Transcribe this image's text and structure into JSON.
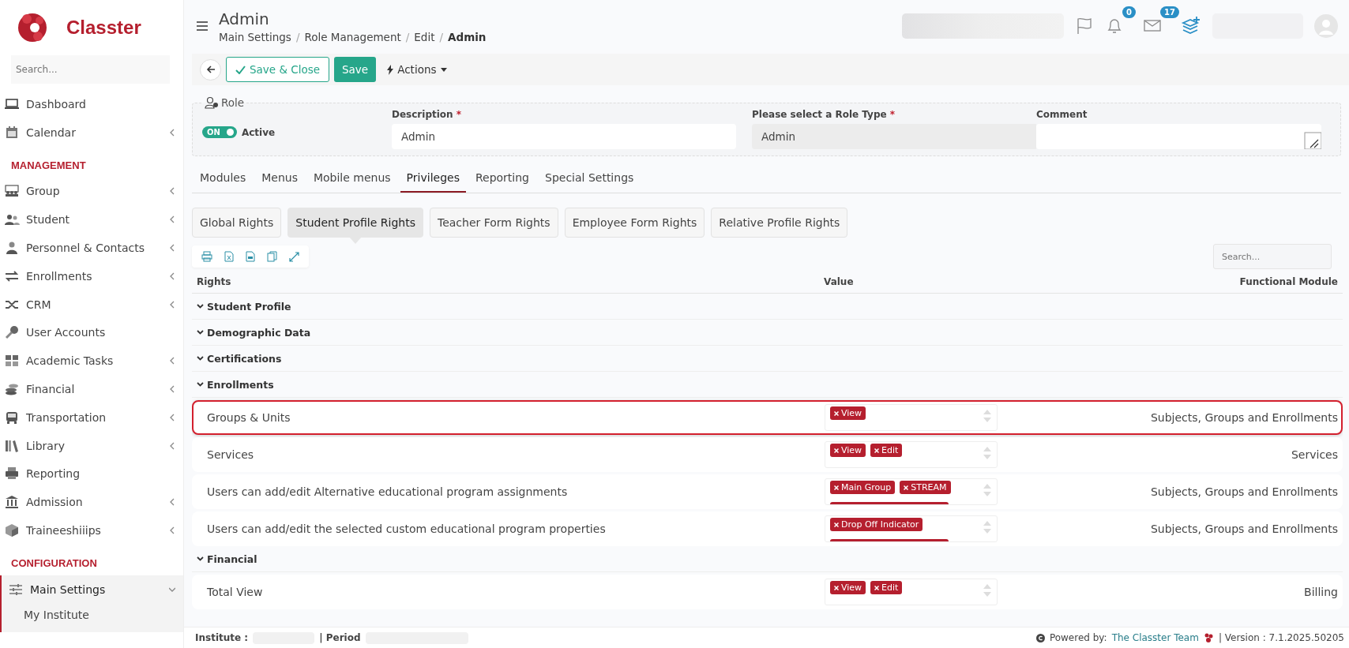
{
  "brand": {
    "name": "Classter"
  },
  "sidebar": {
    "search_placeholder": "Search...",
    "sections": [
      {
        "items": [
          {
            "label": "Dashboard",
            "expandable": false,
            "selected": false
          },
          {
            "label": "Calendar",
            "expandable": true,
            "selected": false
          }
        ]
      },
      {
        "heading": "MANAGEMENT",
        "items": [
          {
            "label": "Group",
            "expandable": true,
            "selected": false
          },
          {
            "label": "Student",
            "expandable": true,
            "selected": false
          },
          {
            "label": "Personnel & Contacts",
            "expandable": true,
            "selected": false
          },
          {
            "label": "Enrollments",
            "expandable": true,
            "selected": false
          },
          {
            "label": "CRM",
            "expandable": true,
            "selected": false
          },
          {
            "label": "User Accounts",
            "expandable": false,
            "selected": false
          },
          {
            "label": "Academic Tasks",
            "expandable": true,
            "selected": false
          },
          {
            "label": "Financial",
            "expandable": true,
            "selected": false
          },
          {
            "label": "Transportation",
            "expandable": true,
            "selected": false
          },
          {
            "label": "Library",
            "expandable": true,
            "selected": false
          },
          {
            "label": "Reporting",
            "expandable": false,
            "selected": false
          },
          {
            "label": "Admission",
            "expandable": true,
            "selected": false
          },
          {
            "label": "Traineeshiiips",
            "expandable": true,
            "selected": false
          }
        ]
      },
      {
        "heading": "CONFIGURATION",
        "items": [
          {
            "label": "Main Settings",
            "expandable": true,
            "expanded": true,
            "selected": true,
            "children": [
              {
                "label": "My Institute"
              }
            ]
          }
        ]
      }
    ]
  },
  "header": {
    "title": "Admin",
    "breadcrumb": [
      "Main Settings",
      "Role Management",
      "Edit",
      "Admin"
    ],
    "breadcrumb_separator": "/",
    "notifications": "0",
    "messages": "17"
  },
  "toolbar": {
    "save_close": "Save & Close",
    "save": "Save",
    "actions": "Actions"
  },
  "role": {
    "legend": "Role",
    "toggle": {
      "label": "ON",
      "on": true
    },
    "active_label": "Active",
    "required_mark": "*",
    "description_label": "Description",
    "description_required": true,
    "type_required": true,
    "description": "Admin",
    "type_label": "Please select a Role Type",
    "type": "Admin",
    "comment_label": "Comment"
  },
  "tabs": [
    {
      "label": "Modules",
      "selected": false
    },
    {
      "label": "Menus",
      "selected": false
    },
    {
      "label": "Mobile menus",
      "selected": false
    },
    {
      "label": "Privileges",
      "selected": true
    },
    {
      "label": "Reporting",
      "selected": false
    },
    {
      "label": "Special Settings",
      "selected": false
    }
  ],
  "subtabs": [
    {
      "label": "Global Rights",
      "selected": false
    },
    {
      "label": "Student Profile Rights",
      "selected": true
    },
    {
      "label": "Teacher Form Rights",
      "selected": false
    },
    {
      "label": "Employee Form Rights",
      "selected": false
    },
    {
      "label": "Relative Profile Rights",
      "selected": false
    }
  ],
  "table": {
    "search_placeholder": "Search...",
    "columns": [
      "Rights",
      "Value",
      "Functional Module"
    ],
    "rows": [
      {
        "kind": "group",
        "label": "Student Profile",
        "expanded": true
      },
      {
        "kind": "group",
        "label": "Demographic Data",
        "expanded": true
      },
      {
        "kind": "group",
        "label": "Certifications",
        "expanded": true
      },
      {
        "kind": "group",
        "label": "Enrollments",
        "expanded": true
      },
      {
        "kind": "right",
        "label": "Groups & Units",
        "tags": [
          "View"
        ],
        "module": "Subjects, Groups and Enrollments",
        "highlighted": true
      },
      {
        "kind": "right",
        "label": "Services",
        "tags": [
          "View",
          "Edit"
        ],
        "module": "Services",
        "highlighted": false
      },
      {
        "kind": "right",
        "label": "Users can add/edit Alternative educational program assignments",
        "tags": [
          "Main Group",
          "STREAM"
        ],
        "more_tags": true,
        "module": "Subjects, Groups and Enrollments",
        "highlighted": false
      },
      {
        "kind": "right",
        "label": "Users can add/edit the selected custom educational program properties",
        "tags": [
          "Drop Off Indicator"
        ],
        "more_tags": true,
        "module": "Subjects, Groups and Enrollments",
        "highlighted": false
      },
      {
        "kind": "group",
        "label": "Financial",
        "expanded": true
      },
      {
        "kind": "right",
        "label": "Total View",
        "tags": [
          "View",
          "Edit"
        ],
        "module": "Billing",
        "highlighted": false
      }
    ]
  },
  "footer": {
    "institute_label": "Institute :",
    "period_label": "| Period",
    "powered": "Powered by:",
    "team": "The Classter Team",
    "version": "| Version : 7.1.2025.50205"
  }
}
